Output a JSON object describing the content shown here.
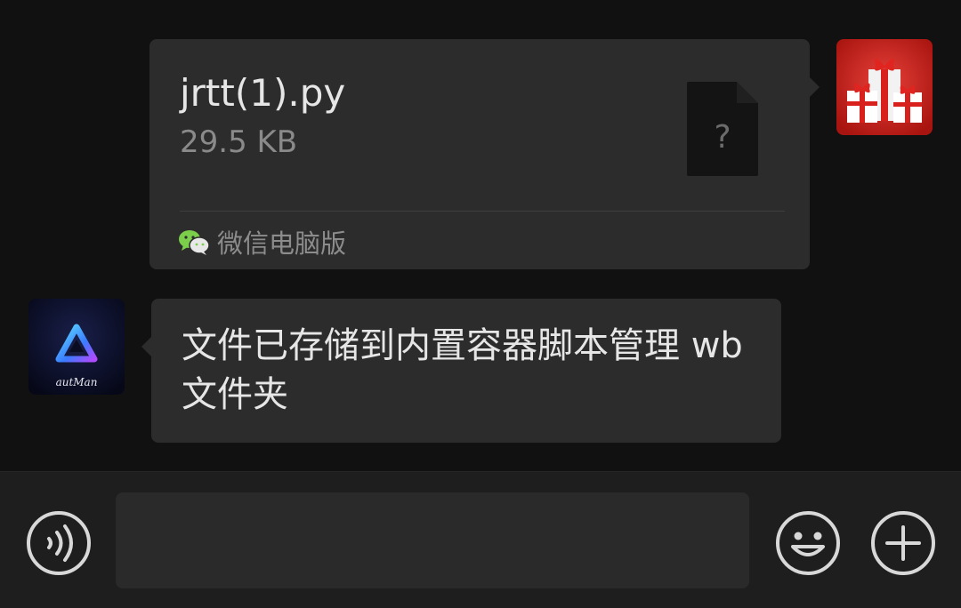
{
  "messages": [
    {
      "direction": "outgoing",
      "type": "file",
      "file_name": "jrtt(1).py",
      "file_size": "29.5 KB",
      "file_icon": "unknown-file-icon",
      "file_icon_glyph": "?",
      "source_icon": "wechat-icon",
      "source_label": "微信电脑版",
      "avatar_icon": "gift-boxes-avatar"
    },
    {
      "direction": "incoming",
      "type": "text",
      "text": "文件已存储到内置容器脚本管理 wb 文件夹",
      "avatar_icon": "autman-logo-avatar",
      "avatar_logo_text": "autMan"
    }
  ],
  "input_bar": {
    "voice_icon": "voice-icon",
    "input_value": "",
    "emoji_icon": "emoji-icon",
    "plus_icon": "plus-icon"
  },
  "colors": {
    "background": "#111111",
    "bubble": "#2c2c2c",
    "input_bar": "#1e1e1e",
    "text_primary": "#e6e6e6",
    "text_secondary": "#8a8a8a",
    "wechat_green": "#7bcf4a",
    "autman_accent": "#3fb8ff",
    "avatar_gift_red": "#d22a22"
  }
}
